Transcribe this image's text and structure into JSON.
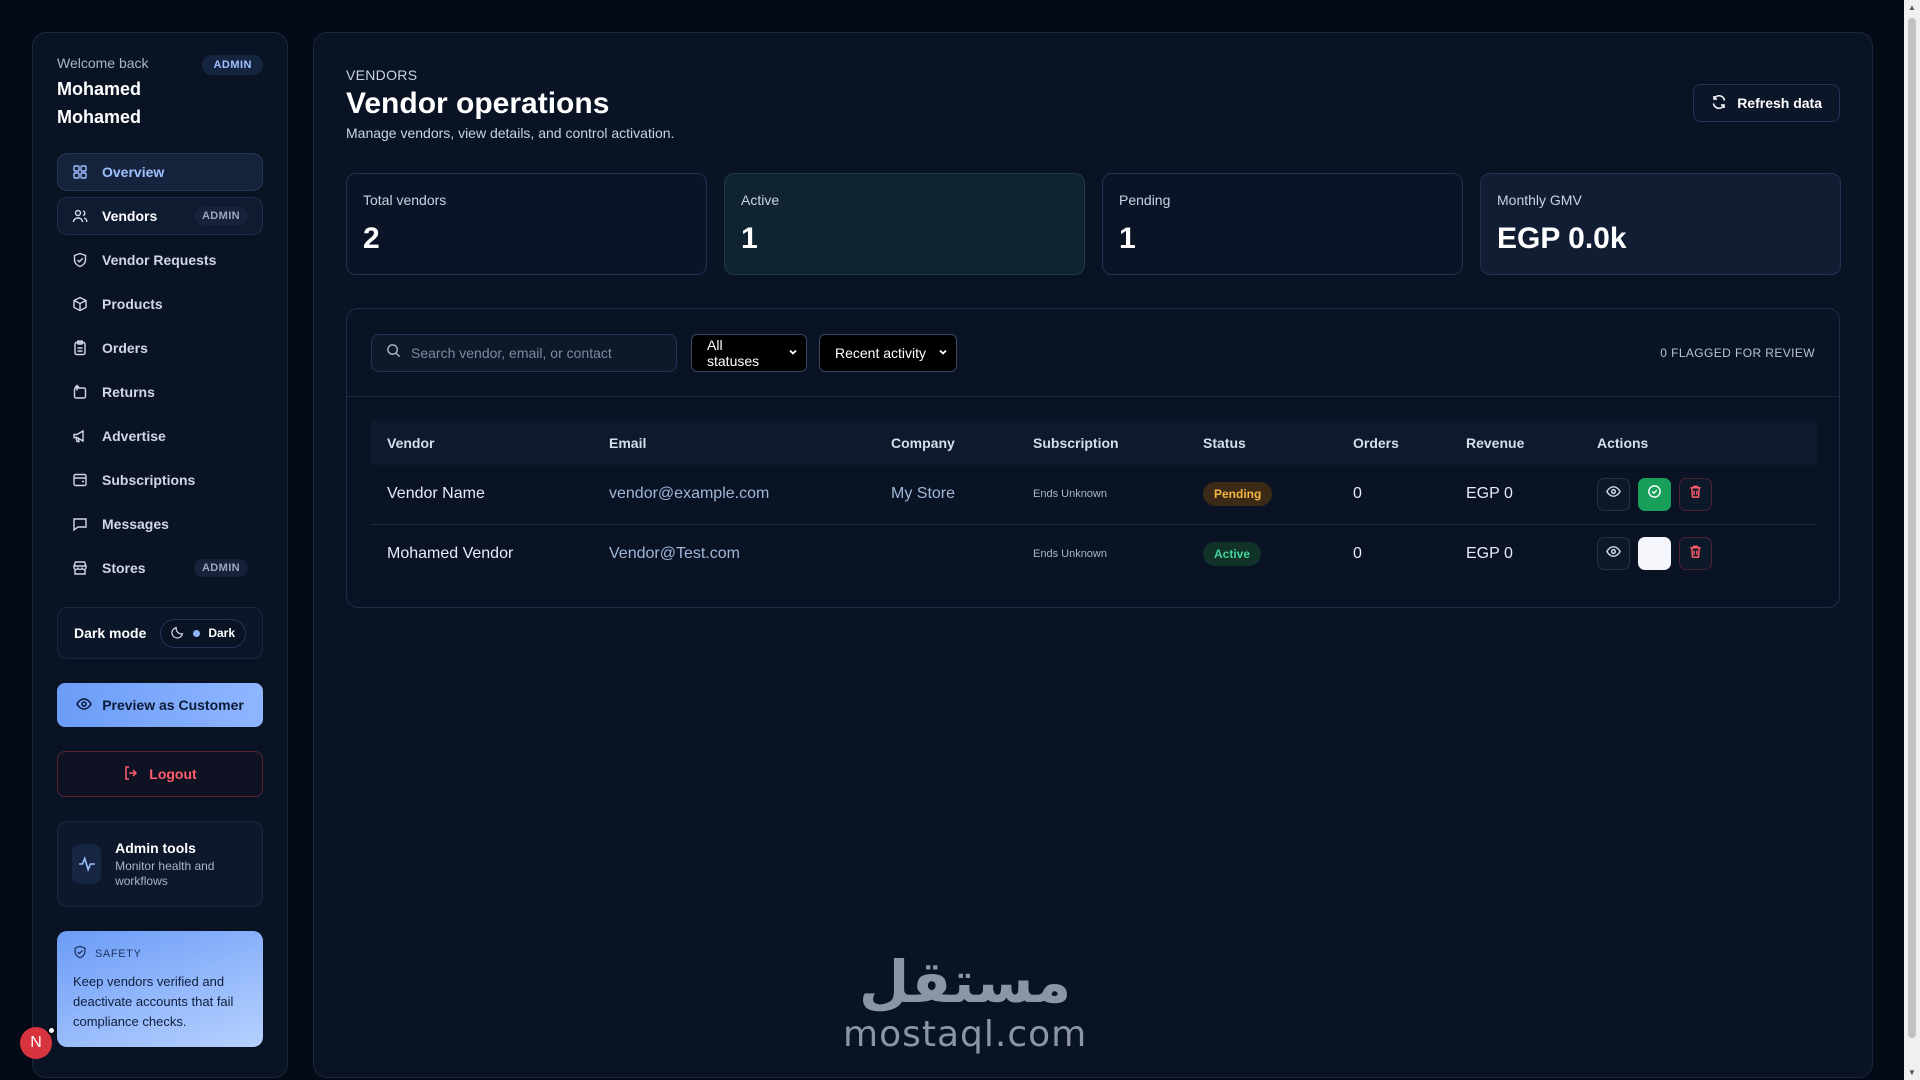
{
  "sidebar": {
    "welcome": "Welcome back",
    "user_name_line1": "Mohamed",
    "user_name_line2": "Mohamed",
    "role_badge": "ADMIN",
    "items": [
      {
        "label": "Overview",
        "icon": "grid-icon",
        "badge": ""
      },
      {
        "label": "Vendors",
        "icon": "users-icon",
        "badge": "ADMIN"
      },
      {
        "label": "Vendor Requests",
        "icon": "shield-check-icon",
        "badge": ""
      },
      {
        "label": "Products",
        "icon": "package-icon",
        "badge": ""
      },
      {
        "label": "Orders",
        "icon": "clipboard-icon",
        "badge": ""
      },
      {
        "label": "Returns",
        "icon": "return-icon",
        "badge": ""
      },
      {
        "label": "Advertise",
        "icon": "megaphone-icon",
        "badge": ""
      },
      {
        "label": "Subscriptions",
        "icon": "receipt-icon",
        "badge": ""
      },
      {
        "label": "Messages",
        "icon": "chat-icon",
        "badge": ""
      },
      {
        "label": "Stores",
        "icon": "store-icon",
        "badge": "ADMIN"
      }
    ],
    "dark_mode_label": "Dark mode",
    "dark_mode_value": "Dark",
    "preview_button": "Preview as Customer",
    "logout_button": "Logout",
    "admin_tools_title": "Admin tools",
    "admin_tools_sub": "Monitor health and workflows",
    "safety_title": "SAFETY",
    "safety_text": "Keep vendors verified and deactivate accounts that fail compliance checks.",
    "avatar_letter": "N"
  },
  "header": {
    "crumb": "VENDORS",
    "title": "Vendor operations",
    "subtitle": "Manage vendors, view details, and control activation.",
    "refresh_button": "Refresh data"
  },
  "stats": [
    {
      "label": "Total vendors",
      "value": "2"
    },
    {
      "label": "Active",
      "value": "1"
    },
    {
      "label": "Pending",
      "value": "1"
    },
    {
      "label": "Monthly GMV",
      "value": "EGP 0.0k"
    }
  ],
  "filters": {
    "search_placeholder": "Search vendor, email, or contact",
    "status_select": "All statuses",
    "sort_select": "Recent activity",
    "flagged": "0 FLAGGED FOR REVIEW"
  },
  "table": {
    "columns": [
      "Vendor",
      "Email",
      "Company",
      "Subscription",
      "Status",
      "Orders",
      "Revenue",
      "Actions"
    ],
    "rows": [
      {
        "vendor": "Vendor Name",
        "email": "vendor@example.com",
        "company": "My Store",
        "subscription": "Ends Unknown",
        "status": "Pending",
        "orders": "0",
        "revenue": "EGP 0"
      },
      {
        "vendor": "Mohamed Vendor",
        "email": "Vendor@Test.com",
        "company": "",
        "subscription": "Ends Unknown",
        "status": "Active",
        "orders": "0",
        "revenue": "EGP 0"
      }
    ]
  },
  "watermark": {
    "arabic": "مستقل",
    "latin": "mostaql.com"
  },
  "colors": {
    "background": "#050b16",
    "accent": "#8fb6ff",
    "pending": "#f5b544",
    "active": "#46d39a",
    "danger": "#ff5d6c"
  }
}
